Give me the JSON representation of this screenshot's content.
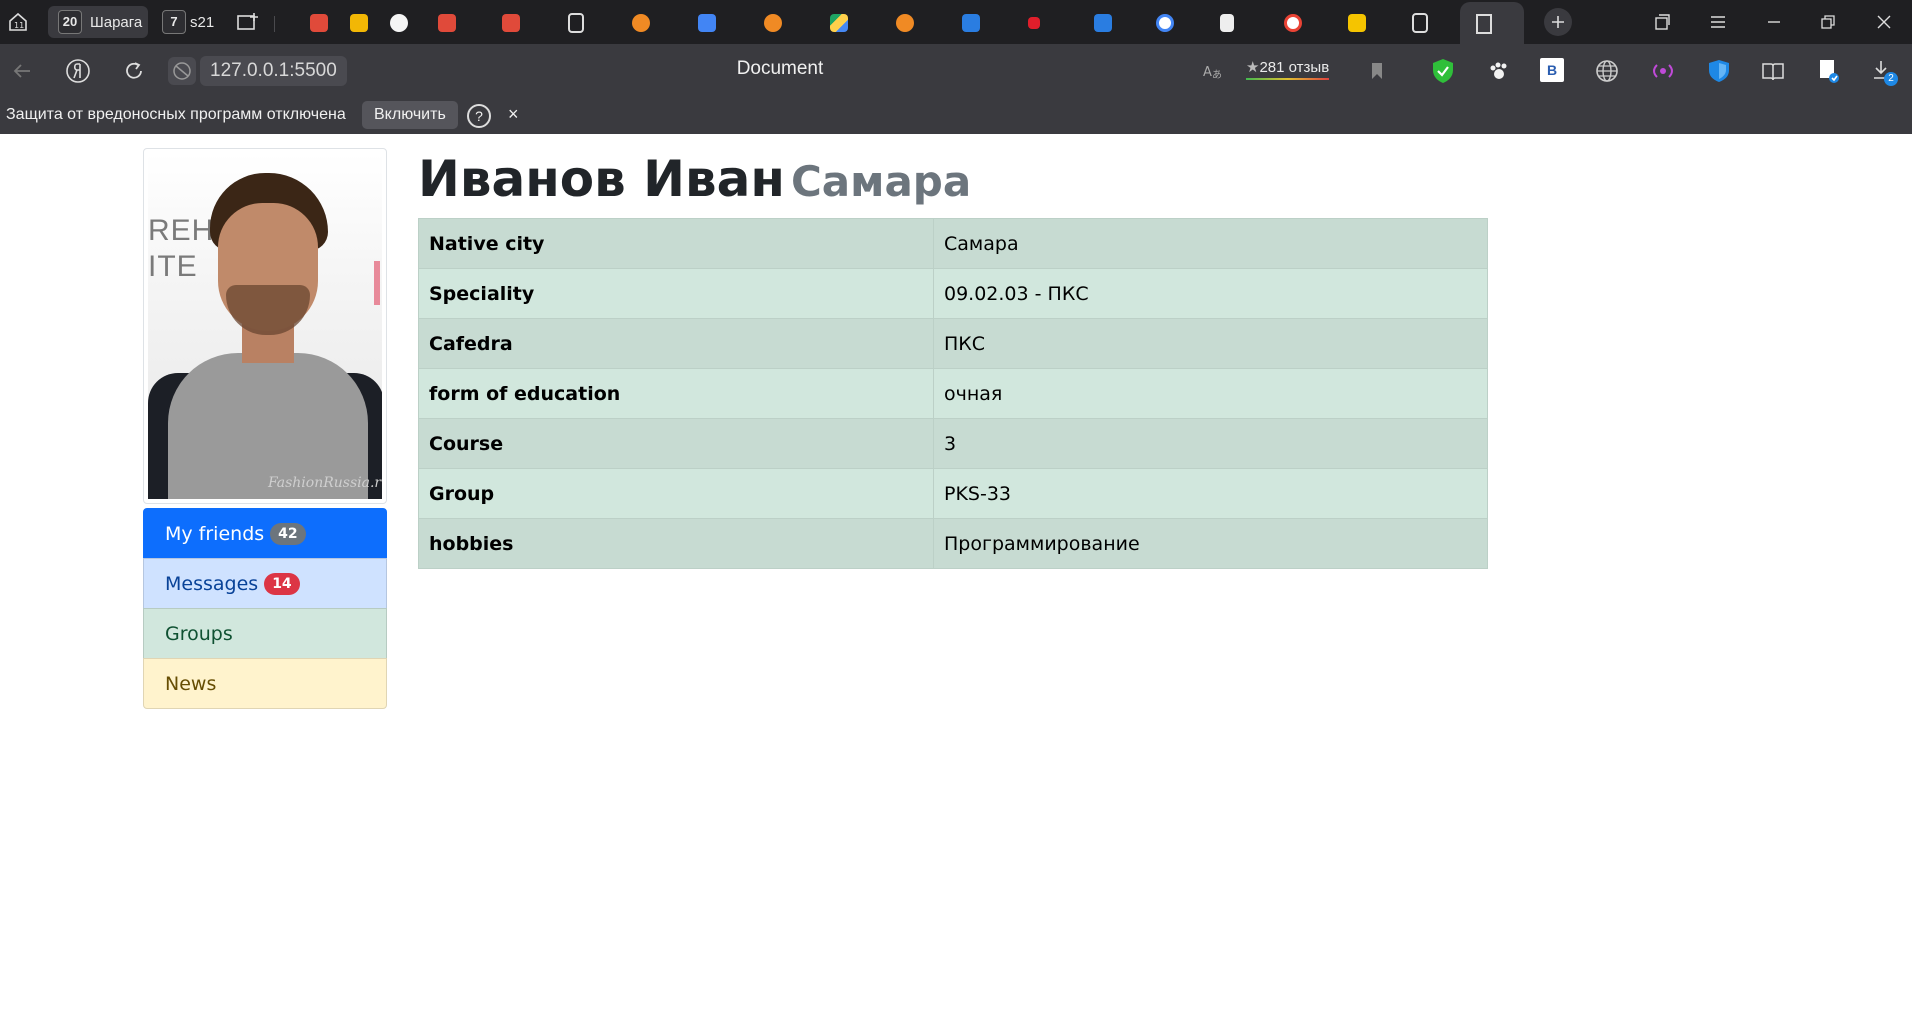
{
  "browser": {
    "tab_groups": [
      {
        "count": "20",
        "label": "Шарага"
      },
      {
        "count": "7",
        "label": "s21"
      }
    ],
    "page_title": "Document",
    "url": "127.0.0.1:5500",
    "reviews": "281 отзыв",
    "extension_badge": "B",
    "downloads_count": "2",
    "infobar": {
      "message": "Защита от вредоносных программ отключена",
      "enable_label": "Включить",
      "help_label": "?",
      "close_label": "×"
    }
  },
  "profile": {
    "name": "Иванов Иван",
    "city": "Самара",
    "photo_text": "REH\nITE",
    "photo_watermark": "FashionRussia.ru",
    "menu": [
      {
        "label": "My friends",
        "badge": "42"
      },
      {
        "label": "Messages",
        "badge": "14"
      },
      {
        "label": "Groups"
      },
      {
        "label": "News"
      }
    ],
    "table": [
      {
        "key": "Native city",
        "value": "Самара"
      },
      {
        "key": "Speciality",
        "value": "09.02.03 - ПКС"
      },
      {
        "key": "Cafedra",
        "value": "ПКС"
      },
      {
        "key": "form of education",
        "value": "очная"
      },
      {
        "key": "Course",
        "value": "3"
      },
      {
        "key": "Group",
        "value": "PKS-33"
      },
      {
        "key": "hobbies",
        "value": "Программирование"
      }
    ]
  },
  "colors": {
    "primary": "#0d6efd",
    "table_success": "#d1e7dd",
    "badge_secondary": "#6c757d",
    "badge_danger": "#dc3545"
  }
}
